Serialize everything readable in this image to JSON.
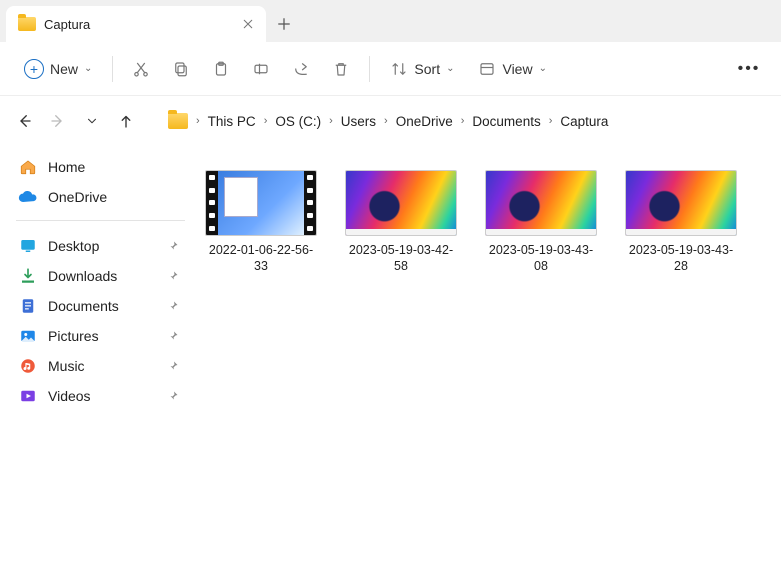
{
  "tab": {
    "title": "Captura"
  },
  "toolbar": {
    "new_label": "New",
    "sort_label": "Sort",
    "view_label": "View"
  },
  "breadcrumbs": {
    "0": "This PC",
    "1": "OS (C:)",
    "2": "Users",
    "3": "OneDrive",
    "4": "Documents",
    "5": "Captura"
  },
  "sidebar": {
    "home": "Home",
    "onedrive": "OneDrive",
    "desktop": "Desktop",
    "downloads": "Downloads",
    "documents": "Documents",
    "pictures": "Pictures",
    "music": "Music",
    "videos": "Videos"
  },
  "files": {
    "0": {
      "name": "2022-01-06-22-56-33"
    },
    "1": {
      "name": "2023-05-19-03-42-58"
    },
    "2": {
      "name": "2023-05-19-03-43-08"
    },
    "3": {
      "name": "2023-05-19-03-43-28"
    }
  }
}
